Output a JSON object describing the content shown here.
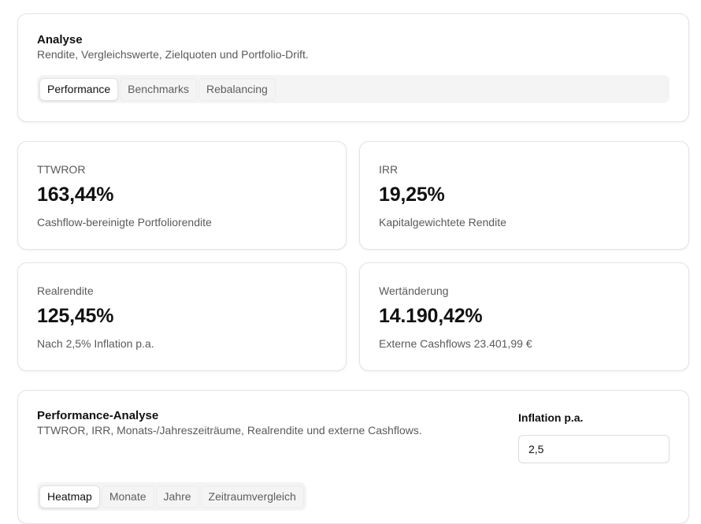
{
  "analyse": {
    "title": "Analyse",
    "subtitle": "Rendite, Vergleichswerte, Zielquoten und Portfolio-Drift.",
    "tabs": [
      {
        "label": "Performance",
        "active": true
      },
      {
        "label": "Benchmarks",
        "active": false
      },
      {
        "label": "Rebalancing",
        "active": false
      }
    ]
  },
  "metrics": [
    {
      "label": "TTWROR",
      "value": "163,44%",
      "description": "Cashflow-bereinigte Portfoliorendite"
    },
    {
      "label": "IRR",
      "value": "19,25%",
      "description": "Kapitalgewichtete Rendite"
    },
    {
      "label": "Realrendite",
      "value": "125,45%",
      "description": "Nach 2,5% Inflation p.a."
    },
    {
      "label": "Wertänderung",
      "value": "14.190,42%",
      "description": "Externe Cashflows 23.401,99 €"
    }
  ],
  "performance": {
    "title": "Performance-Analyse",
    "subtitle": "TTWROR, IRR, Monats-/Jahreszeiträume, Realrendite und externe Cashflows.",
    "inflation_label": "Inflation p.a.",
    "inflation_value": "2,5",
    "tabs": [
      {
        "label": "Heatmap",
        "active": true
      },
      {
        "label": "Monate",
        "active": false
      },
      {
        "label": "Jahre",
        "active": false
      },
      {
        "label": "Zeitraumvergleich",
        "active": false
      }
    ]
  }
}
